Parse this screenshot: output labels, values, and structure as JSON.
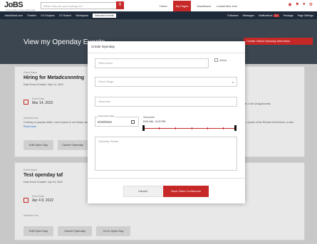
{
  "topbar": {
    "logo": "JoBS",
    "logo_sub": "...where talent meets opportunity",
    "search_placeholder": "What Jobs are you looking for?",
    "search_icon": "search-icon",
    "links": [
      "Home",
      "My Pages",
      "Dashboard",
      "Leads/Jobs Icon",
      "Package",
      "Page Settings"
    ],
    "active_link": "My Pages"
  },
  "navbar": {
    "left": [
      "JobsGlobal.com",
      "Timeline",
      "CV Dropbox",
      "CV Search",
      "Workspace",
      "Interview Events"
    ],
    "active": "Interview Events",
    "right": [
      "Followers",
      "Messages",
      "Notifications",
      "Package",
      "Page Settings"
    ],
    "notif_count": "12"
  },
  "banner": {
    "title": "View my Openday Events",
    "create_button": "Create Virtual Openday Interviews"
  },
  "cards": [
    {
      "label": "Event Name",
      "title": "Hiring for Metadcsnnntng",
      "created": "Date Event Created : Mar 14, 2022",
      "date_label": "Event Date",
      "date": "Mar 14, 2022",
      "right_info": "rts  1  Aim (6 Applicants)",
      "desc_label": "Interview Info",
      "desc": "Contrary to popular belief, Lorem Ipsum is not simply random text...",
      "desc_right": "n spoke of the Richard McClintock, a Latin",
      "read_more": "Read more",
      "buttons": [
        "Edit Open Day",
        "Cancel Openday"
      ]
    },
    {
      "label": "Event Name",
      "title": "Test openday taf",
      "created": "Date Event Created : Apr 04, 2022",
      "date_label": "Event Date",
      "date": "Apr 4 8, 2022",
      "desc_label": "Interview Info",
      "buttons": [
        "Edit Open Day",
        "Cancel Openday",
        "Go to Open Day"
      ]
    }
  ],
  "modal": {
    "title": "Create Openday",
    "title_placeholder": "Title/Lesson",
    "active_label": "Active",
    "stage_placeholder": "Select Stage",
    "vacancies_placeholder": "Vacancies",
    "date_label": "Date-Event Date",
    "date_value": "6/18/2022",
    "schedule_label": "Schedule",
    "schedule_value": "8:00 AM - 6:00 PM",
    "details_placeholder": "Openday Details",
    "cancel_label": "Cancel",
    "save_label": "Save Video Conference"
  },
  "colors": {
    "accent": "#c62828",
    "nav": "#1e2a3a"
  }
}
